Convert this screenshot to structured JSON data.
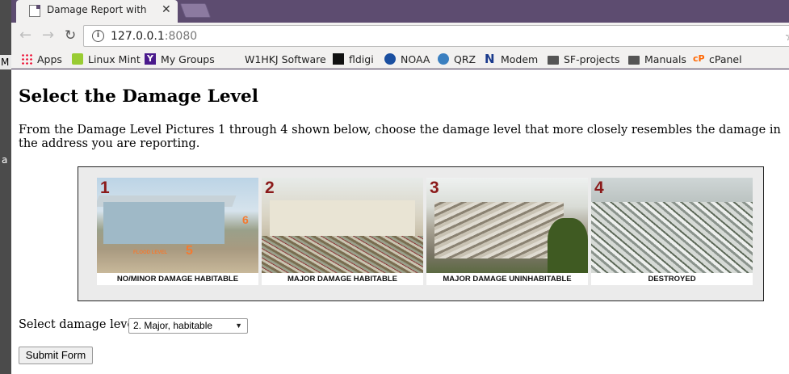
{
  "window": {
    "tab_title": "Damage Report with ",
    "tab_close": "✕",
    "left_partial_letter_m": "M",
    "left_partial_letter_a": "a"
  },
  "toolbar": {
    "url_host": "127.0.0.1",
    "url_port": ":8080",
    "info_glyph": "i",
    "back_glyph": "←",
    "forward_glyph": "→",
    "reload_glyph": "↻",
    "star_glyph": "☆"
  },
  "bookmarks": [
    {
      "label": "Apps",
      "icon": "apps-grid-icon"
    },
    {
      "label": "Linux Mint",
      "icon": "linux-mint-icon"
    },
    {
      "label": "My Groups",
      "icon": "yahoo-icon"
    },
    {
      "label": "W1HKJ Software",
      "icon": "page-icon"
    },
    {
      "label": "fldigi",
      "icon": "fldigi-icon"
    },
    {
      "label": "NOAA",
      "icon": "noaa-icon"
    },
    {
      "label": "QRZ",
      "icon": "qrz-globe-icon"
    },
    {
      "label": "Modem",
      "icon": "modem-icon"
    },
    {
      "label": "SF-projects",
      "icon": "folder-icon"
    },
    {
      "label": "Manuals",
      "icon": "folder-icon"
    },
    {
      "label": "cPanel",
      "icon": "cpanel-icon"
    }
  ],
  "page": {
    "heading": "Select the Damage Level",
    "intro": "From the Damage Level Pictures 1 through 4 shown below, choose the damage level that more closely resembles the damage in the address you are reporting.",
    "pictures": [
      {
        "number": "1",
        "caption": "NO/MINOR DAMAGE HABITABLE",
        "flood_label": "FLOOD LEVEL",
        "marker_5": "5",
        "marker_6": "6"
      },
      {
        "number": "2",
        "caption": "MAJOR DAMAGE HABITABLE"
      },
      {
        "number": "3",
        "caption": "MAJOR DAMAGE UNINHABITABLE"
      },
      {
        "number": "4",
        "caption": "DESTROYED"
      }
    ],
    "select_label": "Select damage level:",
    "select_value": "2. Major, habitable",
    "select_arrow": "▼",
    "submit_label": "Submit Form"
  }
}
